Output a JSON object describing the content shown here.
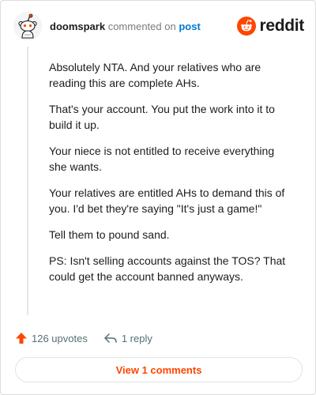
{
  "comment": {
    "author": "doomspark",
    "action": "commented on",
    "target": "post",
    "avatar_icon": "snoo-avatar-icon",
    "paragraphs": [
      "Absolutely NTA. And your relatives who are reading this are complete AHs.",
      "That's your account. You put the work into it to build it up.",
      "Your niece is not entitled to receive everything she wants.",
      "Your relatives are entitled AHs to demand this of you. I'd bet they're saying \"It's just a game!\"",
      "Tell them to pound sand.",
      "PS: Isn't selling accounts against the TOS? That could get the account banned anyways."
    ]
  },
  "brand": {
    "wordmark": "reddit",
    "icon": "reddit-logo-icon",
    "color": "#ff4500"
  },
  "actions": {
    "upvotes_label": "126 upvotes",
    "upvote_icon": "upvote-arrow-icon",
    "reply_label": "1 reply",
    "reply_icon": "reply-arrow-icon"
  },
  "view_comments_label": "View 1 comments",
  "colors": {
    "accent": "#ff4500",
    "link": "#0079d3",
    "muted": "#787c7e"
  }
}
